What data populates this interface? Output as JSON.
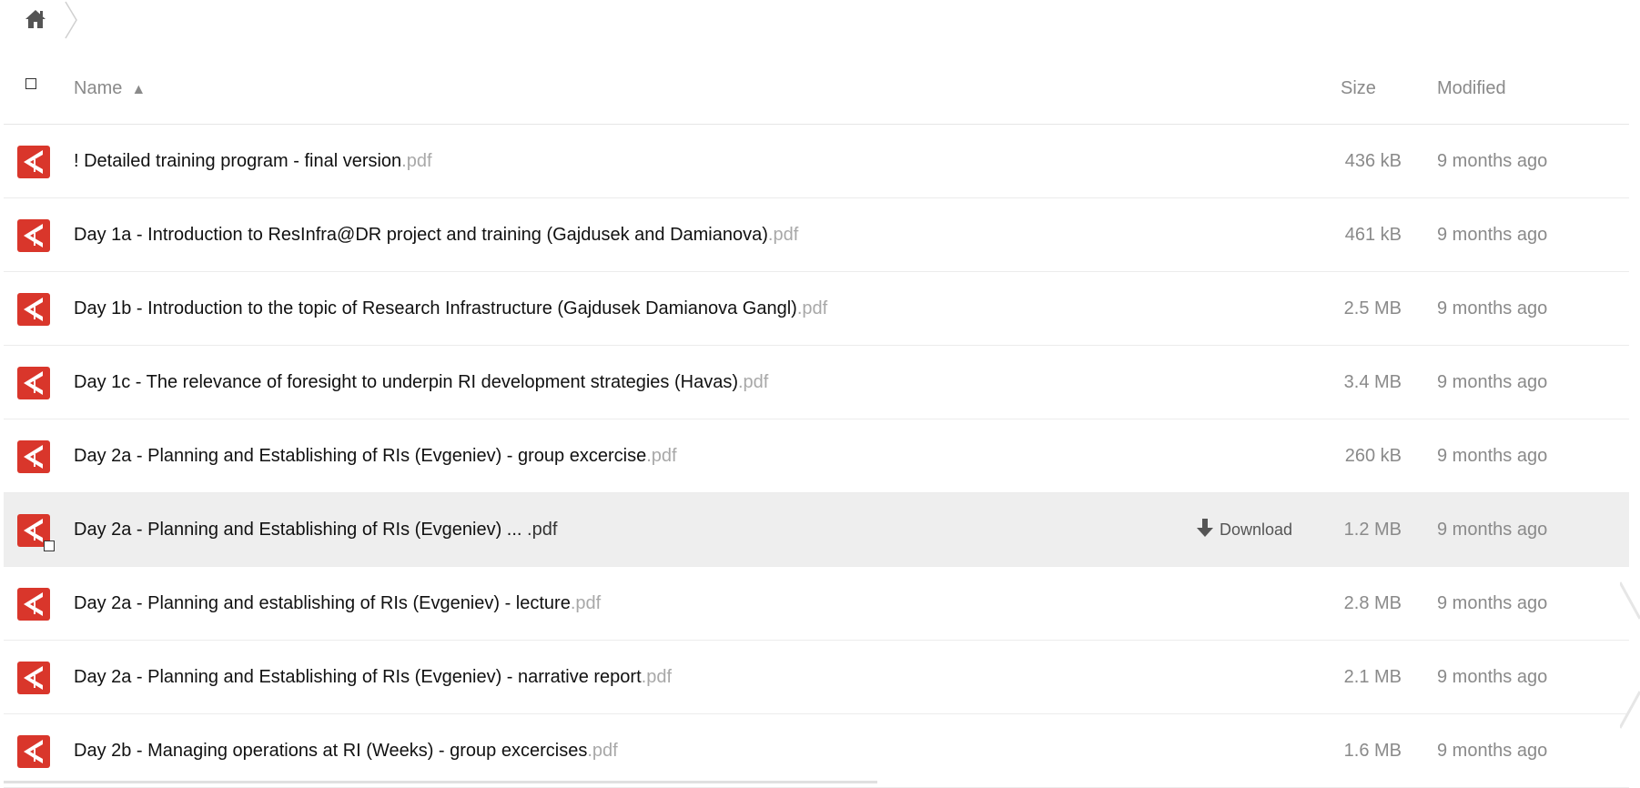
{
  "breadcrumb": {
    "home_icon": "home-icon",
    "separator_icon": "chevron-right-icon"
  },
  "table": {
    "headers": {
      "name": "Name",
      "sort_indicator": "▲",
      "size": "Size",
      "modified": "Modified"
    },
    "rows": [
      {
        "name": "! Detailed training program - final version",
        "ext": ".pdf",
        "size": "436 kB",
        "modified": "9 months ago"
      },
      {
        "name": "Day 1a - Introduction to ResInfra@DR project and training (Gajdusek and Damianova)",
        "ext": ".pdf",
        "size": "461 kB",
        "modified": "9 months ago"
      },
      {
        "name": "Day 1b - Introduction to the topic of Research Infrastructure (Gajdusek Damianova Gangl)",
        "ext": ".pdf",
        "size": "2.5 MB",
        "modified": "9 months ago"
      },
      {
        "name": "Day 1c - The relevance of foresight to underpin RI development strategies (Havas)",
        "ext": ".pdf",
        "size": "3.4 MB",
        "modified": "9 months ago"
      },
      {
        "name": "Day 2a - Planning and Establishing of RIs (Evgeniev) - group excercise",
        "ext": ".pdf",
        "size": "260 kB",
        "modified": "9 months ago"
      },
      {
        "name": "Day 2a - Planning and Establishing of RIs (Evgeniev) ... ",
        "ext": ".pdf",
        "size": "1.2 MB",
        "modified": "9 months ago",
        "download_label": "Download"
      },
      {
        "name": "Day 2a - Planning and establishing of RIs (Evgeniev) - lecture",
        "ext": ".pdf",
        "size": "2.8 MB",
        "modified": "9 months ago"
      },
      {
        "name": "Day 2a - Planning and Establishing of RIs (Evgeniev) - narrative report",
        "ext": ".pdf",
        "size": "2.1 MB",
        "modified": "9 months ago"
      },
      {
        "name": "Day 2b - Managing operations at RI (Weeks) - group excercises",
        "ext": ".pdf",
        "size": "1.6 MB",
        "modified": "9 months ago"
      }
    ]
  },
  "colors": {
    "pdf_icon": "#d9362b",
    "highlight_row": "#eeeeee",
    "muted_text": "#8a8a8a"
  },
  "icons": {
    "file": "pdf-file-icon",
    "download": "download-icon"
  }
}
